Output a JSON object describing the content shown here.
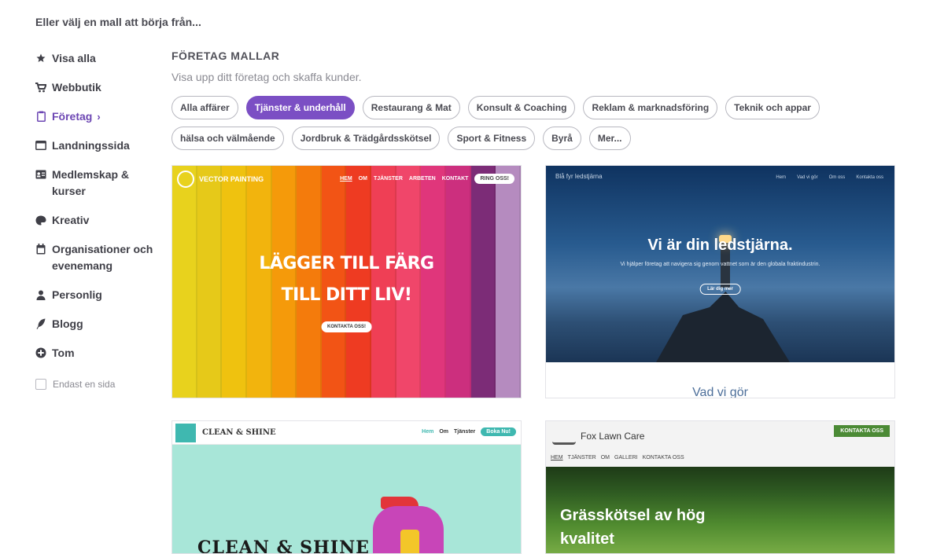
{
  "page": {
    "heading": "Eller välj en mall att börja från..."
  },
  "sidebar": {
    "items": [
      {
        "label": "Visa alla",
        "icon": "star-icon"
      },
      {
        "label": "Webbutik",
        "icon": "cart-icon"
      },
      {
        "label": "Företag",
        "icon": "clipboard-icon",
        "active": true
      },
      {
        "label": "Landningssida",
        "icon": "window-icon"
      },
      {
        "label": "Medlemskap & kurser",
        "icon": "id-card-icon"
      },
      {
        "label": "Kreativ",
        "icon": "palette-icon"
      },
      {
        "label": "Organisationer och evenemang",
        "icon": "calendar-icon"
      },
      {
        "label": "Personlig",
        "icon": "person-icon"
      },
      {
        "label": "Blogg",
        "icon": "feather-icon"
      },
      {
        "label": "Tom",
        "icon": "plus-circle-icon"
      }
    ],
    "checkbox_label": "Endast en sida",
    "active_chevron": "›"
  },
  "main": {
    "title": "FÖRETAG MALLAR",
    "subtitle": "Visa upp ditt företag och skaffa kunder.",
    "chips": [
      {
        "label": "Alla affärer"
      },
      {
        "label": "Tjänster & underhåll",
        "active": true
      },
      {
        "label": "Restaurang & Mat"
      },
      {
        "label": "Konsult & Coaching"
      },
      {
        "label": "Reklam & marknadsföring"
      },
      {
        "label": "Teknik och appar"
      },
      {
        "label": "hälsa och välmående"
      },
      {
        "label": "Jordbruk & Trädgårdsskötsel"
      },
      {
        "label": "Sport & Fitness"
      },
      {
        "label": "Byrå"
      },
      {
        "label": "Mer..."
      }
    ]
  },
  "templates": {
    "vector": {
      "logo": "VECTOR PAINTING",
      "nav": [
        "HEM",
        "OM",
        "TJÄNSTER",
        "ARBETEN",
        "KONTAKT"
      ],
      "cta": "RING OSS!",
      "hero_line1": "LÄGGER TILL FÄRG",
      "hero_line2": "TILL DITT LIV!",
      "button": "KONTAKTA OSS!",
      "stripe_colors": [
        "#e8d21d",
        "#e6c919",
        "#efc20f",
        "#f2b40d",
        "#f59a0a",
        "#f47b0c",
        "#f25415",
        "#ee3b22",
        "#ef3f55",
        "#f0466a",
        "#e0367b",
        "#cc2f7e",
        "#7c2c77",
        "#b58bbf"
      ]
    },
    "lighthouse": {
      "logo": "Blå fyr ledstjärna",
      "nav": [
        "Hem",
        "Vad vi gör",
        "Om oss",
        "Kontakta oss"
      ],
      "title": "Vi är din ledstjärna.",
      "subtitle": "Vi hjälper företag att navigera sig genom vattnet som är den globala fraktindustrin.",
      "button": "Lär dig mer",
      "section": "Vad vi gör"
    },
    "clean": {
      "name": "CLEAN & SHINE",
      "nav": [
        "Hem",
        "Om",
        "Tjänster"
      ],
      "cta": "Boka Nu!",
      "hero": "CLEAN & SHINE"
    },
    "fox": {
      "name": "Fox Lawn Care",
      "button": "KONTAKTA OSS",
      "nav": [
        "HEM",
        "TJÄNSTER",
        "OM",
        "GALLERI",
        "KONTAKTA OSS"
      ],
      "hero": "Grässkötsel av hög kvalitet"
    }
  }
}
